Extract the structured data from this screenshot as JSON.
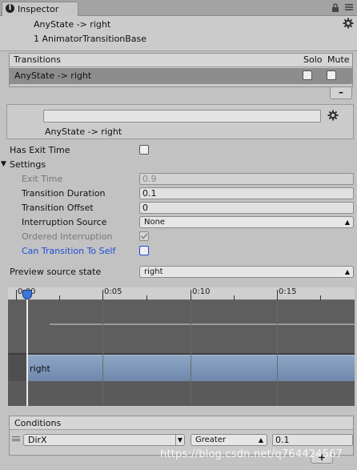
{
  "window": {
    "tab_label": "Inspector",
    "tab_icon": "info-icon",
    "lock_icon": "lock-icon",
    "menu_icon": "menu-icon"
  },
  "header": {
    "title": "AnyState -> right",
    "subtitle": "1 AnimatorTransitionBase",
    "gear_icon": "gear-icon"
  },
  "transitions": {
    "title": "Transitions",
    "solo_label": "Solo",
    "mute_label": "Mute",
    "rows": [
      {
        "label": "AnyState -> right",
        "solo": false,
        "mute": false
      }
    ],
    "remove_label": "–"
  },
  "selected": {
    "name_value": "",
    "label": "AnyState -> right"
  },
  "properties": {
    "has_exit_time_label": "Has Exit Time",
    "has_exit_time": false,
    "settings_label": "Settings",
    "exit_time_label": "Exit Time",
    "exit_time_value": "0.9",
    "transition_duration_label": "Transition Duration",
    "transition_duration_value": "0.1",
    "transition_offset_label": "Transition Offset",
    "transition_offset_value": "0",
    "interruption_source_label": "Interruption Source",
    "interruption_source_value": "None",
    "ordered_interruption_label": "Ordered Interruption",
    "ordered_interruption": true,
    "can_transition_to_self_label": "Can Transition To Self",
    "can_transition_to_self": false,
    "preview_source_state_label": "Preview source state",
    "preview_source_state_value": "right"
  },
  "timeline": {
    "labels": [
      "0:00",
      "0:05",
      "0:10",
      "0:15"
    ],
    "bar_label": "right"
  },
  "conditions": {
    "title": "Conditions",
    "rows": [
      {
        "parameter": "DirX",
        "mode": "Greater",
        "threshold": "0.1"
      }
    ],
    "add_label": "+"
  },
  "watermark": "https://blog.csdn.net/q764424567",
  "colors": {
    "accent_blue": "#1d4fd6",
    "playhead_blue": "#3a78d8",
    "state_bar": "#7f96b8"
  }
}
